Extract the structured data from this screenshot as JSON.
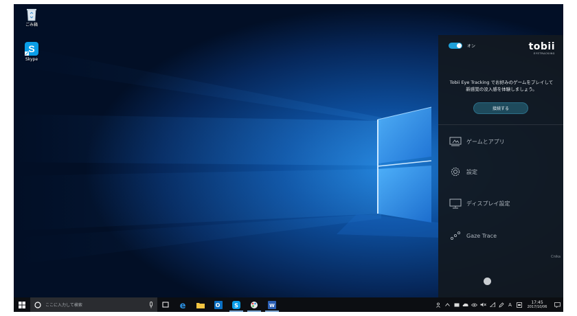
{
  "desktop": {
    "icons": [
      {
        "label": "ごみ箱",
        "icon": "recycle-bin-icon"
      },
      {
        "label": "Skype",
        "icon": "skype-icon"
      }
    ]
  },
  "tobii_panel": {
    "toggle_label": "オン",
    "toggle_on": true,
    "brand_name": "tobii",
    "brand_sub": "EYETRACKING",
    "promo_line1": "Tobii Eye Tracking でお好みのゲームをプレイして",
    "promo_line2": "新感覚の没入感を体験しましょう。",
    "connect_button": "接続する",
    "menu": [
      {
        "label": "ゲームとアプリ",
        "icon": "games-apps-icon"
      },
      {
        "label": "設定",
        "icon": "gear-icon"
      },
      {
        "label": "ディスプレイ設定",
        "icon": "monitor-icon"
      },
      {
        "label": "Gaze Trace",
        "icon": "gaze-trace-icon"
      }
    ],
    "version": "Cnika"
  },
  "taskbar": {
    "search_placeholder": "ここに入力して検索",
    "apps": [
      "task-view-icon",
      "edge-icon",
      "file-explorer-icon",
      "outlook-icon",
      "skype-icon",
      "paint-icon",
      "word-icon"
    ],
    "tray_input_indicator": "A",
    "time": "17:45",
    "date": "2017/10/06"
  },
  "colors": {
    "accent": "#1ea0d8",
    "panel_bg": "#121820",
    "taskbar_bg": "#0c0e12"
  }
}
